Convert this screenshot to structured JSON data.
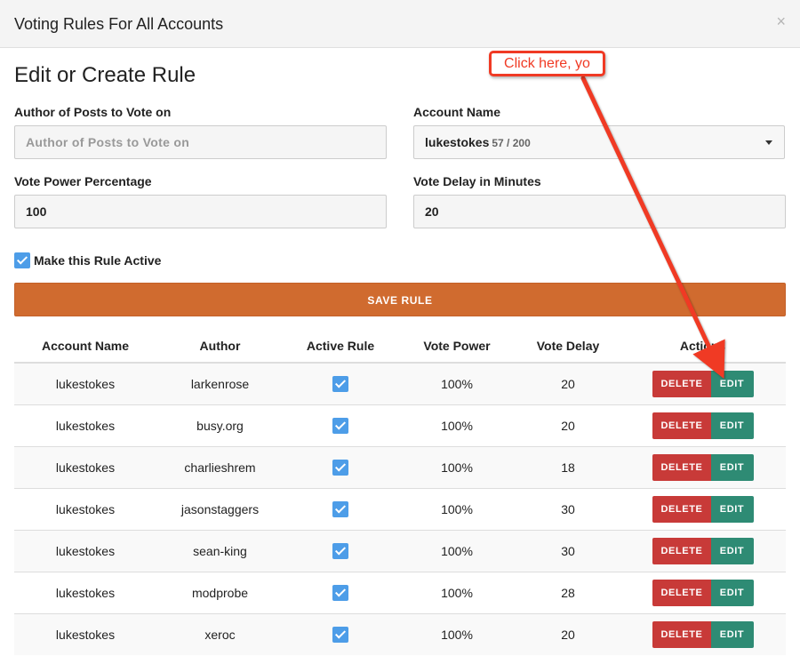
{
  "modal": {
    "title": "Voting Rules For All Accounts",
    "close_glyph": "×"
  },
  "form": {
    "section_title": "Edit or Create Rule",
    "author_label": "Author of Posts to Vote on",
    "author_placeholder": "Author of Posts to Vote on",
    "account_label": "Account Name",
    "account_value": "lukestokes",
    "account_count": "57 / 200",
    "power_label": "Vote Power Percentage",
    "power_value": "100",
    "delay_label": "Vote Delay in Minutes",
    "delay_value": "20",
    "active_label": "Make this Rule Active",
    "save_label": "SAVE RULE"
  },
  "table": {
    "headers": [
      "Account Name",
      "Author",
      "Active Rule",
      "Vote Power",
      "Vote Delay",
      "Actions"
    ],
    "delete_label": "DELETE",
    "edit_label": "EDIT",
    "rows": [
      {
        "account": "lukestokes",
        "author": "larkenrose",
        "active": true,
        "power": "100%",
        "delay": "20"
      },
      {
        "account": "lukestokes",
        "author": "busy.org",
        "active": true,
        "power": "100%",
        "delay": "20"
      },
      {
        "account": "lukestokes",
        "author": "charlieshrem",
        "active": true,
        "power": "100%",
        "delay": "18"
      },
      {
        "account": "lukestokes",
        "author": "jasonstaggers",
        "active": true,
        "power": "100%",
        "delay": "30"
      },
      {
        "account": "lukestokes",
        "author": "sean-king",
        "active": true,
        "power": "100%",
        "delay": "30"
      },
      {
        "account": "lukestokes",
        "author": "modprobe",
        "active": true,
        "power": "100%",
        "delay": "28"
      },
      {
        "account": "lukestokes",
        "author": "xeroc",
        "active": true,
        "power": "100%",
        "delay": "20"
      }
    ]
  },
  "annotation": {
    "callout_text": "Click here, yo",
    "color": "#f03a24"
  },
  "colors": {
    "save": "#d06b2f",
    "delete": "#c83a38",
    "edit": "#2e8b74",
    "checkbox": "#4d9de8"
  }
}
